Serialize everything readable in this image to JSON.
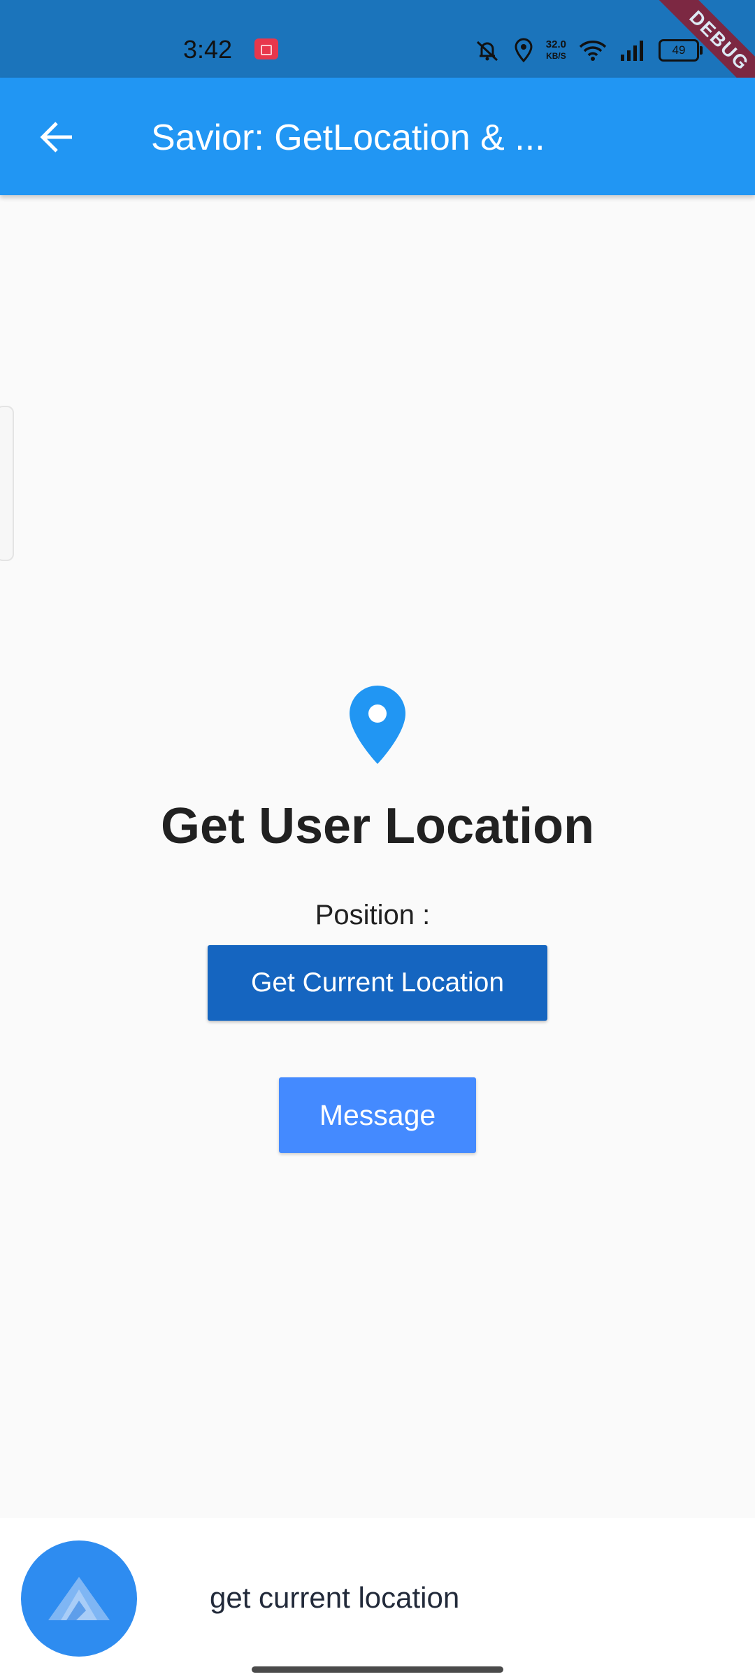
{
  "status_bar": {
    "time": "3:42",
    "net_speed_value": "32.0",
    "net_speed_unit": "KB/S",
    "battery": "49",
    "debug_label": "DEBUG",
    "icons": [
      "screen-record-icon",
      "mute-bell-icon",
      "location-icon",
      "wifi-icon",
      "signal-icon",
      "battery-icon"
    ]
  },
  "app_bar": {
    "title": "Savior: GetLocation & ...",
    "back_icon": "back-arrow-icon",
    "background": "#2196f3"
  },
  "main": {
    "icon": "location-pin-icon",
    "heading": "Get User Location",
    "position_label": "Position :",
    "get_location_button": "Get Current Location",
    "message_button": "Message",
    "colors": {
      "pin": "#2196f3",
      "primary_button": "#1565c0",
      "secondary_button": "#448aff"
    }
  },
  "assistant": {
    "avatar_icon": "assistant-logo-icon",
    "transcript": "get current location"
  }
}
